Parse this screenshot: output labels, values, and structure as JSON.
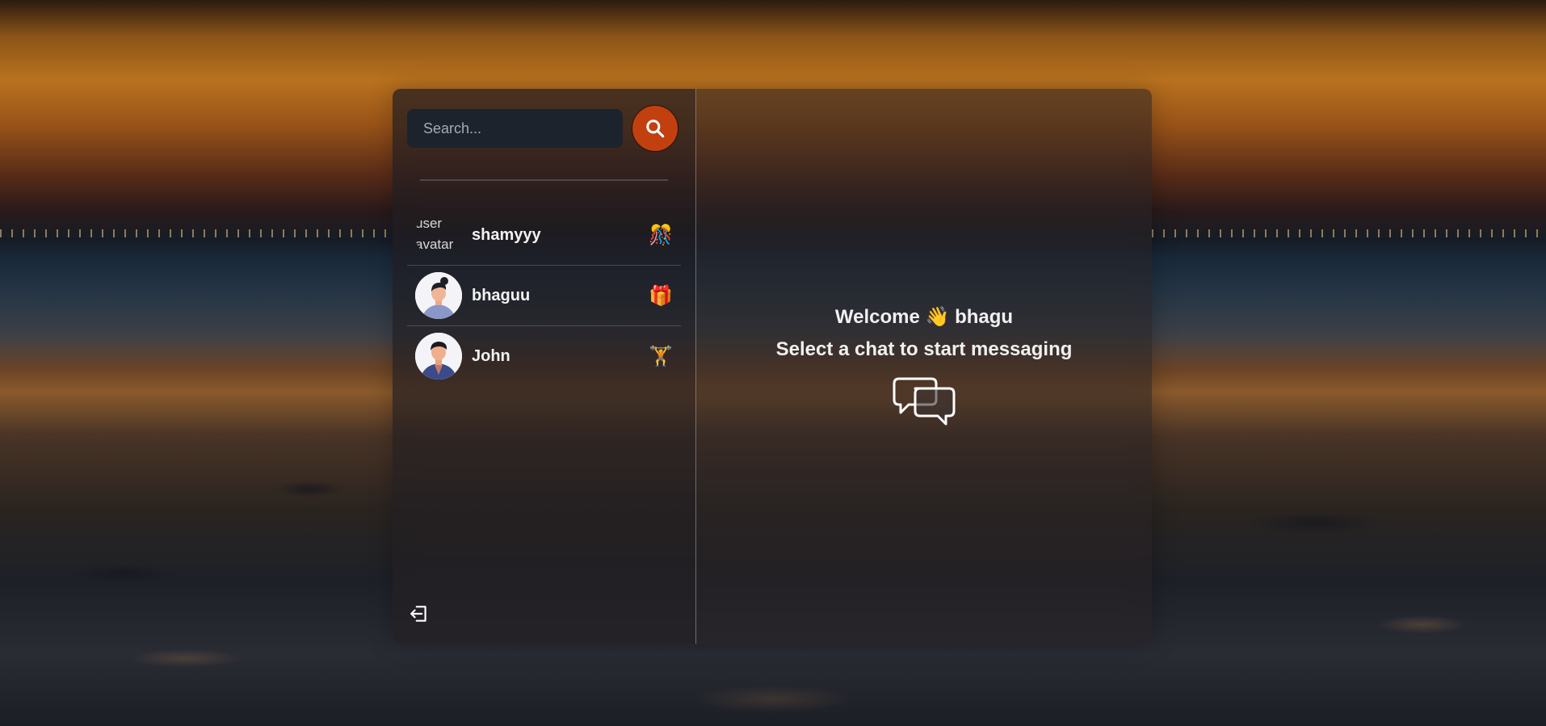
{
  "search": {
    "placeholder": "Search..."
  },
  "conversations": [
    {
      "name": "shamyyy",
      "emoji": "🎊",
      "avatar_alt": "user\navatar",
      "avatar_broken": true
    },
    {
      "name": "bhaguu",
      "emoji": "🎁",
      "avatar_broken": false
    },
    {
      "name": "John",
      "emoji": "🏋",
      "avatar_broken": false
    }
  ],
  "main": {
    "welcome": "Welcome 👋 bhagu",
    "subtitle": "Select a chat to start messaging"
  },
  "colors": {
    "accent": "#c2400f",
    "input_bg": "#1d232d"
  },
  "icons": {
    "search": "search-icon",
    "logout": "logout-icon",
    "chat": "chat-bubbles-icon"
  }
}
